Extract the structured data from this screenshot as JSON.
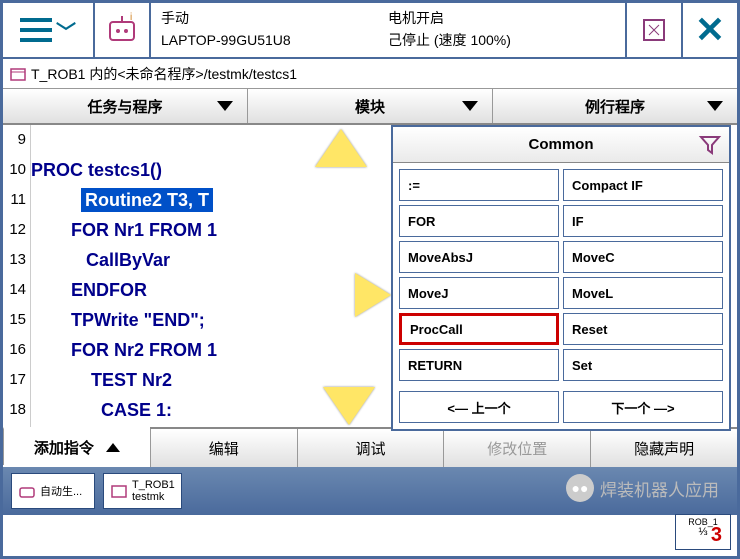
{
  "titlebar": {
    "mode": "手动",
    "machine": "LAPTOP-99GU51U8",
    "motor": "电机开启",
    "stopped": "己停止 (速度 100%)"
  },
  "breadcrumb": "T_ROB1 内的<未命名程序>/testmk/testcs1",
  "tabs1": [
    "任务与程序",
    "模块",
    "例行程序"
  ],
  "gutter": [
    "9",
    "10",
    "11",
    "12",
    "13",
    "14",
    "15",
    "16",
    "17",
    "18"
  ],
  "code": {
    "l0": "",
    "l1": "PROC testcs1()",
    "l2_hl": "Routine2 T3, T",
    "l3": "        FOR Nr1 FROM 1",
    "l4": "           CallByVar",
    "l5": "        ENDFOR",
    "l6": "        TPWrite \"END\";",
    "l7": "        FOR Nr2 FROM 1",
    "l8": "            TEST Nr2",
    "l9": "              CASE 1:"
  },
  "panel": {
    "title": "Common",
    "cells": [
      ":=",
      "Compact IF",
      "FOR",
      "IF",
      "MoveAbsJ",
      "MoveC",
      "MoveJ",
      "MoveL",
      "ProcCall",
      "Reset",
      "RETURN",
      "Set"
    ],
    "prev": "<—  上一个",
    "next": "下一个  —>"
  },
  "tabs2": [
    "添加指令",
    "编辑",
    "调试",
    "修改位置",
    "隐藏声明"
  ],
  "taskbar": {
    "t1": "自动生...",
    "t2a": "T_ROB1",
    "t2b": "testmk"
  },
  "watermark": "焊装机器人应用",
  "corner": {
    "label": "ROB_1",
    "num": "3"
  }
}
